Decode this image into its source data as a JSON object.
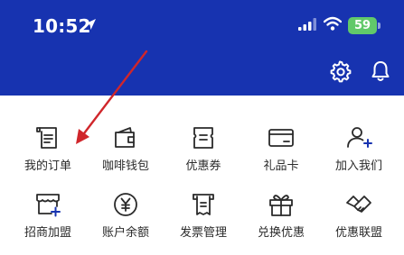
{
  "status_bar": {
    "time": "10:52",
    "battery": "59",
    "battery_color": "#61c96a"
  },
  "header": {
    "background": "#1733b0",
    "icons": [
      "gear-icon",
      "bell-icon"
    ]
  },
  "menu": {
    "row1": [
      {
        "label": "我的订单",
        "icon": "order-list-icon"
      },
      {
        "label": "咖啡钱包",
        "icon": "wallet-icon"
      },
      {
        "label": "优惠券",
        "icon": "coupon-icon"
      },
      {
        "label": "礼品卡",
        "icon": "gift-card-icon"
      },
      {
        "label": "加入我们",
        "icon": "add-person-icon"
      }
    ],
    "row2": [
      {
        "label": "招商加盟",
        "icon": "storefront-add-icon"
      },
      {
        "label": "账户余额",
        "icon": "yuan-coin-icon"
      },
      {
        "label": "发票管理",
        "icon": "invoice-icon"
      },
      {
        "label": "兑换优惠",
        "icon": "gift-box-icon"
      },
      {
        "label": "优惠联盟",
        "icon": "handshake-icon"
      }
    ]
  },
  "annotation": {
    "color": "#d0262b"
  }
}
